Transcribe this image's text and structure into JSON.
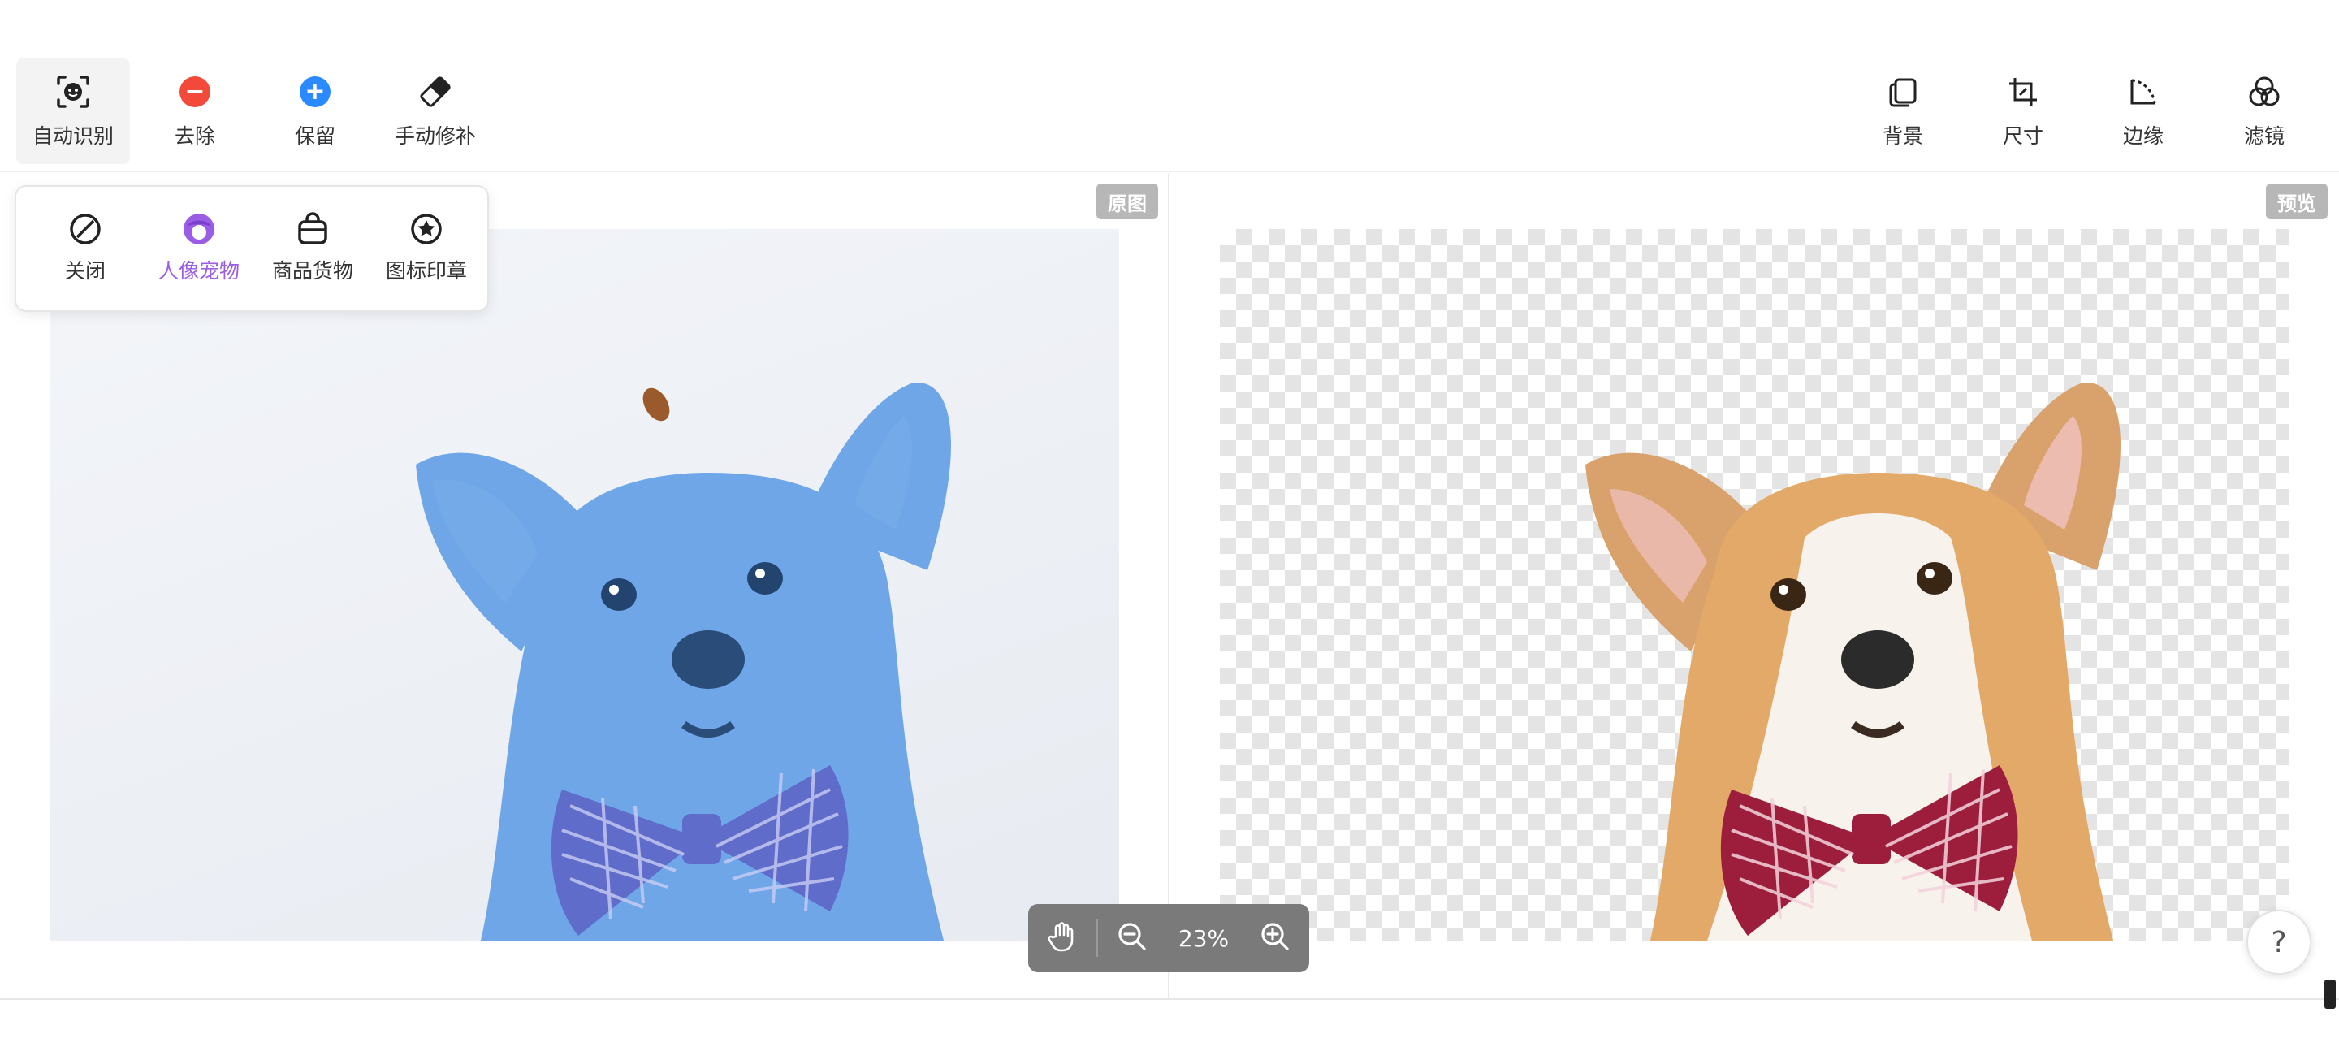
{
  "toolbar": {
    "left_tools": [
      {
        "label": "自动识别",
        "icon": "auto-detect-icon"
      },
      {
        "label": "去除",
        "icon": "remove-icon"
      },
      {
        "label": "保留",
        "icon": "keep-icon"
      },
      {
        "label": "手动修补",
        "icon": "eraser-icon"
      }
    ],
    "right_tools": [
      {
        "label": "背景",
        "icon": "background-icon"
      },
      {
        "label": "尺寸",
        "icon": "crop-icon"
      },
      {
        "label": "边缘",
        "icon": "edge-icon"
      },
      {
        "label": "滤镜",
        "icon": "filter-icon"
      }
    ]
  },
  "recognition_menu": {
    "items": [
      {
        "label": "关闭",
        "icon": "disable-icon"
      },
      {
        "label": "人像宠物",
        "icon": "portrait-icon",
        "selected": true
      },
      {
        "label": "商品货物",
        "icon": "product-bag-icon"
      },
      {
        "label": "图标印章",
        "icon": "stamp-icon"
      }
    ]
  },
  "panels": {
    "original_label": "原图",
    "preview_label": "预览"
  },
  "zoom": {
    "value": "23%",
    "hand_icon": "hand-pan-icon",
    "zoom_out_icon": "zoom-out-icon",
    "zoom_in_icon": "zoom-in-icon"
  },
  "help": {
    "label": "?"
  },
  "colors": {
    "accent_purple": "#9b5de5",
    "remove_red": "#f2493b",
    "keep_blue": "#2b8aff",
    "mask_blue": "#6ea6e8",
    "zoom_bar": "#7a7a7a"
  }
}
